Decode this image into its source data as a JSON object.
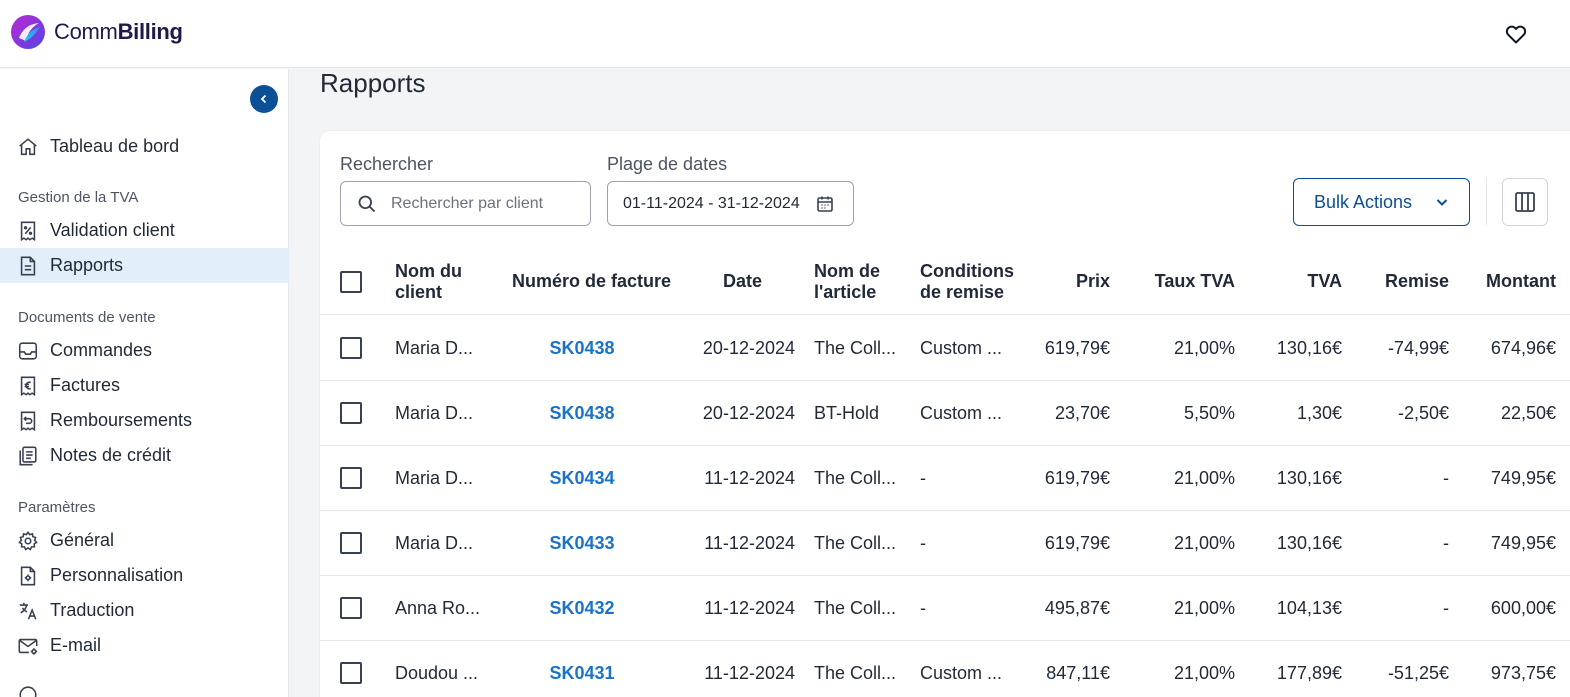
{
  "app": {
    "name_light": "Comm",
    "name_bold": "Billing"
  },
  "sidebar": {
    "dashboard": "Tableau de bord",
    "section_vat": "Gestion de la TVA",
    "client_validation": "Validation client",
    "reports": "Rapports",
    "section_sales": "Documents de vente",
    "orders": "Commandes",
    "invoices": "Factures",
    "refunds": "Remboursements",
    "credit_notes": "Notes de crédit",
    "section_settings": "Paramètres",
    "general": "Général",
    "customization": "Personnalisation",
    "translation": "Traduction",
    "email": "E-mail"
  },
  "page": {
    "title": "Rapports"
  },
  "filters": {
    "search_label": "Rechercher",
    "search_placeholder": "Rechercher par client",
    "search_value": "",
    "date_label": "Plage de dates",
    "date_value": "01-11-2024 - 31-12-2024"
  },
  "toolbar": {
    "bulk_actions": "Bulk Actions"
  },
  "table": {
    "headers": {
      "client_1": "Nom du",
      "client_2": "client",
      "invoice": "Numéro de facture",
      "date": "Date",
      "article_1": "Nom de",
      "article_2": "l'article",
      "conditions_1": "Conditions",
      "conditions_2": "de remise",
      "price": "Prix",
      "vat_rate": "Taux TVA",
      "vat": "TVA",
      "discount": "Remise",
      "amount": "Montant"
    },
    "rows": [
      {
        "client": "Maria D...",
        "invoice": "SK0438",
        "date": "20-12-2024",
        "article": "The Coll...",
        "conditions": "Custom ...",
        "price": "619,79€",
        "vat_rate": "21,00%",
        "vat": "130,16€",
        "discount": "-74,99€",
        "amount": "674,96€"
      },
      {
        "client": "Maria D...",
        "invoice": "SK0438",
        "date": "20-12-2024",
        "article": "BT-Hold",
        "conditions": "Custom ...",
        "price": "23,70€",
        "vat_rate": "5,50%",
        "vat": "1,30€",
        "discount": "-2,50€",
        "amount": "22,50€"
      },
      {
        "client": "Maria D...",
        "invoice": "SK0434",
        "date": "11-12-2024",
        "article": "The Coll...",
        "conditions": "-",
        "price": "619,79€",
        "vat_rate": "21,00%",
        "vat": "130,16€",
        "discount": "-",
        "amount": "749,95€"
      },
      {
        "client": "Maria D...",
        "invoice": "SK0433",
        "date": "11-12-2024",
        "article": "The Coll...",
        "conditions": "-",
        "price": "619,79€",
        "vat_rate": "21,00%",
        "vat": "130,16€",
        "discount": "-",
        "amount": "749,95€"
      },
      {
        "client": "Anna Ro...",
        "invoice": "SK0432",
        "date": "11-12-2024",
        "article": "The Coll...",
        "conditions": "-",
        "price": "495,87€",
        "vat_rate": "21,00%",
        "vat": "104,13€",
        "discount": "-",
        "amount": "600,00€"
      },
      {
        "client": "Doudou ...",
        "invoice": "SK0431",
        "date": "11-12-2024",
        "article": "The Coll...",
        "conditions": "Custom ...",
        "price": "847,11€",
        "vat_rate": "21,00%",
        "vat": "177,89€",
        "discount": "-51,25€",
        "amount": "973,75€"
      }
    ]
  },
  "colors": {
    "primary": "#0b4f94",
    "link": "#1a73c8",
    "active_bg": "#e3eefb"
  }
}
